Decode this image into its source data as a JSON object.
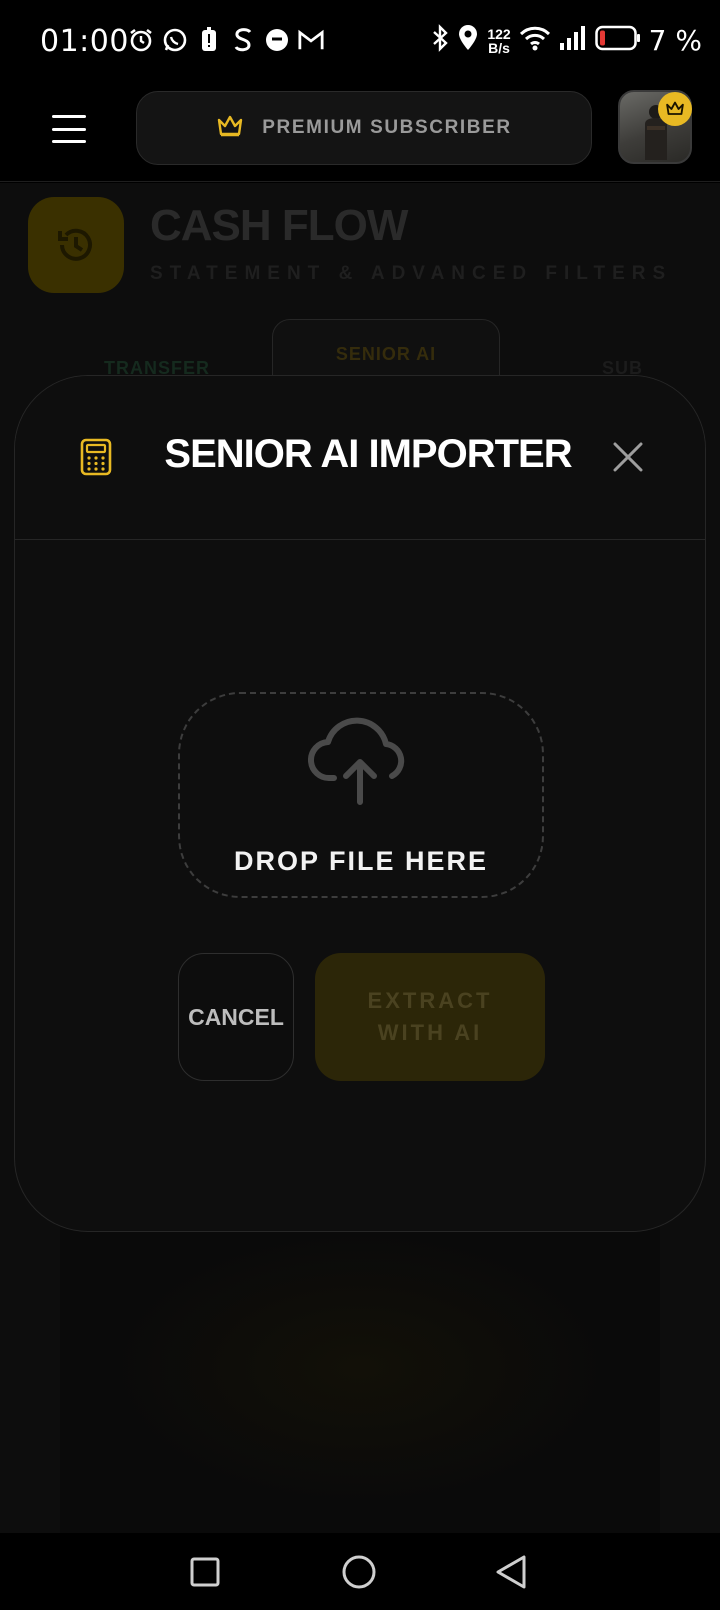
{
  "status_bar": {
    "time": "01:00",
    "net_speed_top": "122",
    "net_speed_bottom": "B/s",
    "battery": "7 %"
  },
  "header": {
    "premium_label": "PREMIUM SUBSCRIBER"
  },
  "background": {
    "title": "CASH FLOW",
    "subtitle": "STATEMENT & ADVANCED FILTERS",
    "tabs": [
      "TRANSFER",
      "SENIOR AI",
      "SUB"
    ]
  },
  "modal": {
    "title": "SENIOR AI IMPORTER",
    "drop_label": "DROP FILE HERE",
    "cancel_label": "CANCEL",
    "extract_label": "EXTRACT WITH AI"
  },
  "colors": {
    "accent": "#e8b923",
    "background": "#000000",
    "modal": "#0e0e0e"
  }
}
